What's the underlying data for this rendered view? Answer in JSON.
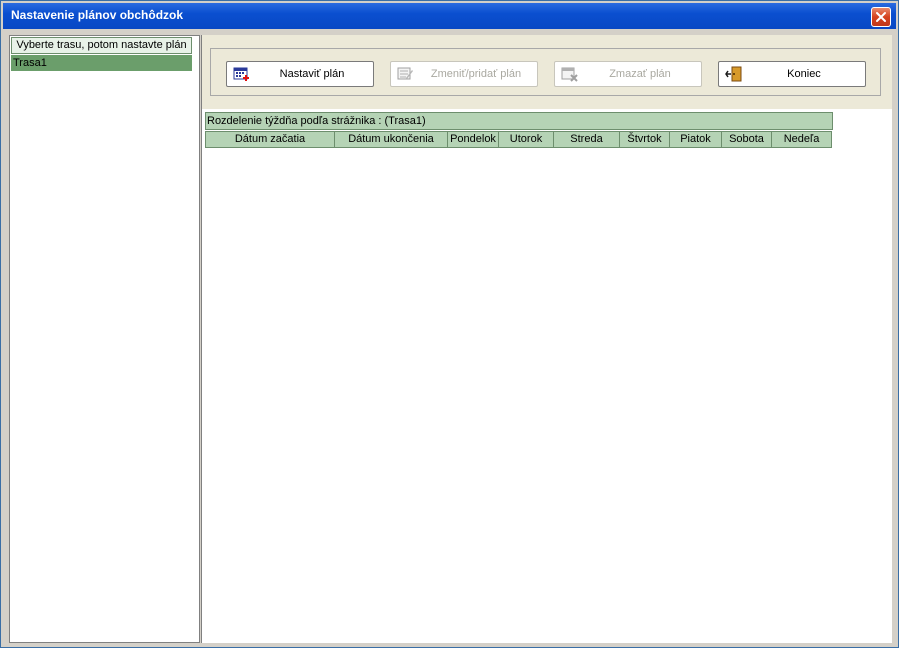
{
  "window": {
    "title": "Nastavenie plánov obchôdzok"
  },
  "routes": {
    "header": "Vyberte trasu, potom nastavte plán",
    "items": [
      "Trasa1"
    ]
  },
  "toolbar": {
    "set_plan": "Nastaviť plán",
    "change_add_plan": "Zmeniť/pridať plán",
    "delete_plan": "Zmazať plán",
    "exit": "Koniec"
  },
  "grid": {
    "title": "Rozdelenie týždňa podľa strážnika :  (Trasa1)",
    "columns": [
      "Dátum začatia",
      "Dátum ukončenia",
      "Pondelok",
      "Utorok",
      "Streda",
      "Štvrtok",
      "Piatok",
      "Sobota",
      "Nedeľa"
    ],
    "rows": []
  },
  "colors": {
    "title_bar": "#0a4fd0",
    "grid_header": "#b5d3b5",
    "selected_row": "#6b9e6b"
  }
}
